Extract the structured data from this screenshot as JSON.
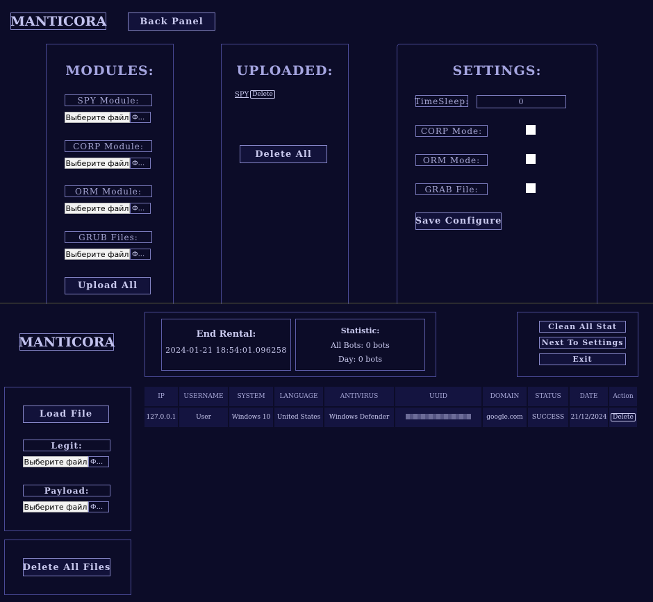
{
  "header": {
    "logo": "MANTICORA",
    "back_panel": "Back Panel"
  },
  "modules": {
    "title": "MODULES:",
    "items": [
      {
        "label": "SPY Module:",
        "choose": "Выберите файл",
        "fname": "Ф..."
      },
      {
        "label": "CORP Module:",
        "choose": "Выберите файл",
        "fname": "Ф..."
      },
      {
        "label": "ORM Module:",
        "choose": "Выберите файл",
        "fname": "Ф..."
      },
      {
        "label": "GRUB Files:",
        "choose": "Выберите файл",
        "fname": "Ф..."
      }
    ],
    "upload_all": "Upload All"
  },
  "uploaded": {
    "title": "UPLOADED:",
    "item": {
      "name": "SPY",
      "delete": "Delete"
    },
    "delete_all": "Delete All"
  },
  "settings": {
    "title": "SETTINGS:",
    "timesleep_label": "TimeSleep:",
    "timesleep_value": "0",
    "corp_mode": "CORP Mode:",
    "orm_mode": "ORM Mode:",
    "grab_file": "GRAB File:",
    "save": "Save Configure"
  },
  "panel2": {
    "logo": "MANTICORA",
    "rental": {
      "title": "End Rental:",
      "date": "2024-01-21 18:54:01.096258"
    },
    "stats": {
      "title": "Statistic:",
      "all_bots": "All Bots: 0 bots",
      "day": "Day: 0 bots"
    },
    "actions": {
      "clean": "Clean All Stat",
      "next": "Next To Settings",
      "exit": "Exit"
    }
  },
  "loader": {
    "load_file": "Load File",
    "legit": "Legit:",
    "payload": "Payload:",
    "choose": "Выберите файл",
    "fname": "Ф...",
    "delete_all_files": "Delete All Files"
  },
  "table": {
    "headers": [
      "IP",
      "USERNAME",
      "SYSTEM",
      "LANGUAGE",
      "ANTIVIRUS",
      "UUID",
      "DOMAIN",
      "STATUS",
      "DATE",
      "Action"
    ],
    "row": {
      "ip": "127.0.0.1",
      "username": "User",
      "system": "Windows 10",
      "language": "United States",
      "antivirus": "Windows Defender",
      "domain": "google.com",
      "status": "SUCCESS",
      "date": "21/12/2024",
      "action": "Delete"
    }
  }
}
